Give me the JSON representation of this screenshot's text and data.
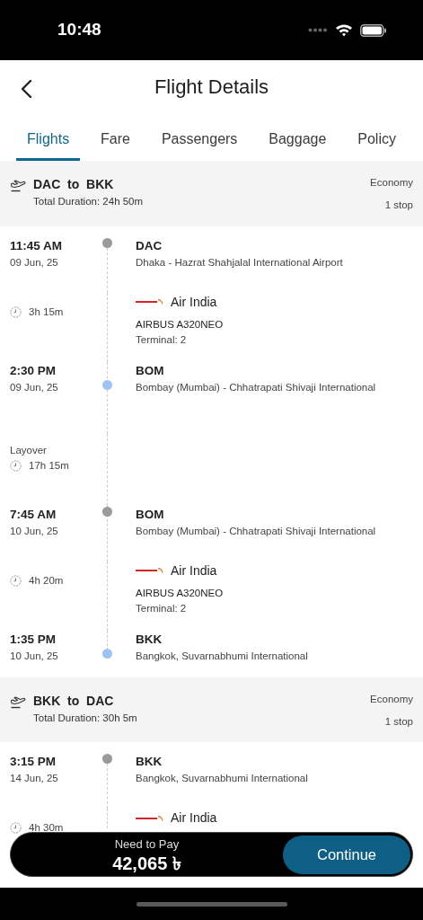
{
  "status_bar": {
    "time": "10:48"
  },
  "header": {
    "title": "Flight Details"
  },
  "tabs": [
    {
      "label": "Flights",
      "selected": true
    },
    {
      "label": "Fare",
      "selected": false
    },
    {
      "label": "Passengers",
      "selected": false
    },
    {
      "label": "Baggage",
      "selected": false
    },
    {
      "label": "Policy",
      "selected": false
    }
  ],
  "legs": [
    {
      "route": "DAC  to  BKK",
      "total_duration": "Total Duration: 24h 50m",
      "cabin": "Economy",
      "stops": "1 stop",
      "items": [
        {
          "kind": "departure",
          "time": "11:45 AM",
          "date": "09 Jun, 25",
          "code": "DAC",
          "airport": "Dhaka - Hazrat Shahjalal International Airport"
        },
        {
          "kind": "segment",
          "duration": "3h 15m",
          "airline": "Air India",
          "aircraft": "AIRBUS A320NEO",
          "terminal": "Terminal: 2"
        },
        {
          "kind": "arrival",
          "time": "2:30 PM",
          "date": "09 Jun, 25",
          "code": "BOM",
          "airport": "Bombay (Mumbai) - Chhatrapati Shivaji International"
        },
        {
          "kind": "layover",
          "label": "Layover",
          "duration": "17h 15m"
        },
        {
          "kind": "departure",
          "time": "7:45 AM",
          "date": "10 Jun, 25",
          "code": "BOM",
          "airport": "Bombay (Mumbai) - Chhatrapati Shivaji International"
        },
        {
          "kind": "segment",
          "duration": "4h 20m",
          "airline": "Air India",
          "aircraft": "AIRBUS A320NEO",
          "terminal": "Terminal: 2"
        },
        {
          "kind": "arrival",
          "time": "1:35 PM",
          "date": "10 Jun, 25",
          "code": "BKK",
          "airport": "Bangkok, Suvarnabhumi International"
        }
      ]
    },
    {
      "route": "BKK  to  DAC",
      "total_duration": "Total Duration: 30h 5m",
      "cabin": "Economy",
      "stops": "1 stop",
      "items": [
        {
          "kind": "departure",
          "time": "3:15 PM",
          "date": "14 Jun, 25",
          "code": "BKK",
          "airport": "Bangkok, Suvarnabhumi International"
        },
        {
          "kind": "segment",
          "duration": "4h 30m",
          "airline": "Air India"
        }
      ]
    }
  ],
  "pay_bar": {
    "label": "Need to Pay",
    "amount": "42,065 ৳",
    "button": "Continue"
  }
}
